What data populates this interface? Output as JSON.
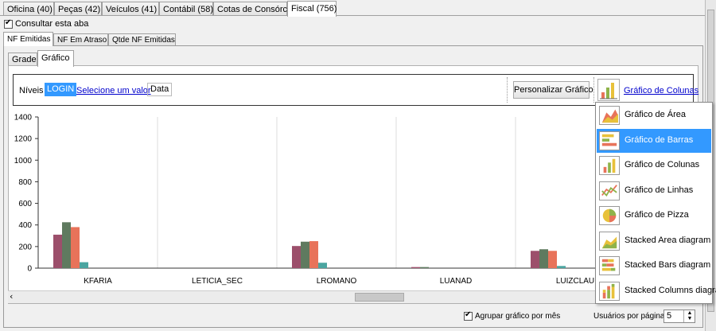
{
  "top_tabs": [
    {
      "label": "Oficina (40)"
    },
    {
      "label": "Peças (42)"
    },
    {
      "label": "Veículos (41)"
    },
    {
      "label": "Contábil (58)"
    },
    {
      "label": "Cotas de Consórcio"
    },
    {
      "label": "Fiscal (756)"
    }
  ],
  "consultar_label": "Consultar esta aba",
  "sub_tabs": [
    {
      "label": "NF Emitidas"
    },
    {
      "label": "NF Em Atraso"
    },
    {
      "label": "Qtde NF Emitidas"
    }
  ],
  "view_tabs": [
    {
      "label": "Grade"
    },
    {
      "label": "Gráfico"
    }
  ],
  "toolbar": {
    "niveis_label": "Níveis",
    "login_badge": "LOGIN",
    "select_link": "Selecione um valor",
    "data_label": "Data",
    "personalizar_button": "Personalizar Gráfico",
    "chart_type_link": "Gráfico de Colunas"
  },
  "chart_menu": [
    {
      "label": "Gráfico de Área",
      "icon": "area-chart-icon",
      "selected": false
    },
    {
      "label": "Gráfico de Barras",
      "icon": "bar-chart-icon",
      "selected": true
    },
    {
      "label": "Gráfico de Colunas",
      "icon": "column-chart-icon",
      "selected": false
    },
    {
      "label": "Gráfico de Linhas",
      "icon": "line-chart-icon",
      "selected": false
    },
    {
      "label": "Gráfico de Pizza",
      "icon": "pie-chart-icon",
      "selected": false
    },
    {
      "label": "Stacked Area diagram",
      "icon": "stacked-area-icon",
      "selected": false
    },
    {
      "label": "Stacked Bars diagram",
      "icon": "stacked-bars-icon",
      "selected": false
    },
    {
      "label": "Stacked Columns diagram",
      "icon": "stacked-columns-icon",
      "selected": false
    }
  ],
  "chart_data": {
    "type": "bar",
    "categories": [
      "KFARIA",
      "LETICIA_SEC",
      "LROMANO",
      "LUANAD",
      "LUIZCLAU"
    ],
    "ylim": [
      0,
      1400
    ],
    "yticks": [
      "0",
      "200",
      "400",
      "600",
      "800",
      "1000",
      "1200",
      "1400"
    ],
    "grid": true,
    "series": [
      {
        "color": "#9c4f6b",
        "values": [
          310,
          0,
          205,
          10,
          160
        ]
      },
      {
        "color": "#5f7a5f",
        "values": [
          425,
          0,
          245,
          10,
          175
        ]
      },
      {
        "color": "#e8735a",
        "values": [
          380,
          0,
          250,
          0,
          160
        ]
      },
      {
        "color": "#4ba5a0",
        "values": [
          55,
          0,
          50,
          0,
          20
        ]
      }
    ]
  },
  "footer": {
    "agrupar_label": "Agrupar gráfico por mês",
    "usuarios_label": "Usuários por página",
    "usuarios_value": "5"
  }
}
